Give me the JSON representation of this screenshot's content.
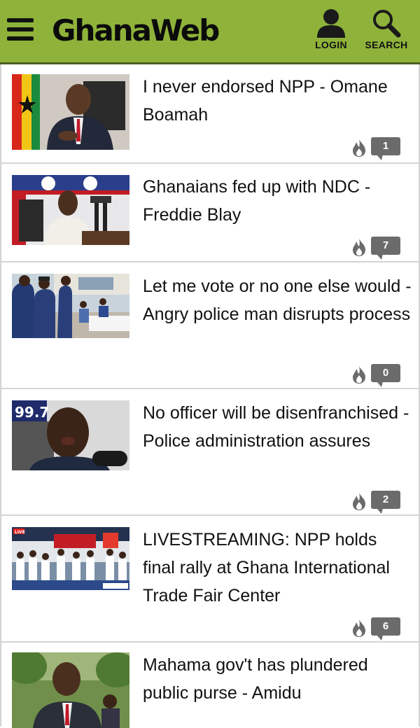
{
  "header": {
    "logo_text": "GhanaWeb",
    "login_label": "LOGIN",
    "search_label": "SEARCH",
    "brand_color": "#8fb33a"
  },
  "articles": [
    {
      "title": "I never endorsed NPP - Omane Boamah",
      "comments": "1"
    },
    {
      "title": "Ghanaians fed up with NDC - Freddie Blay",
      "comments": "7"
    },
    {
      "title": "Let me vote or no one else would - Angry police man disrupts process",
      "comments": "0"
    },
    {
      "title": "No officer will be disenfranchised - Police administration assures",
      "comments": "2"
    },
    {
      "title": "LIVESTREAMING: NPP holds final rally at Ghana International Trade Fair Center",
      "comments": "6"
    },
    {
      "title": "Mahama gov't has plundered public purse - Amidu",
      "comments": ""
    }
  ],
  "thumbnail_overlays": {
    "badge_997": "99.7",
    "live_badge": "LIVE"
  },
  "icons": {
    "menu": "hamburger-icon",
    "login": "user-icon",
    "search": "magnifier-icon",
    "hot": "flame-icon",
    "comments": "comment-bubble-icon"
  }
}
